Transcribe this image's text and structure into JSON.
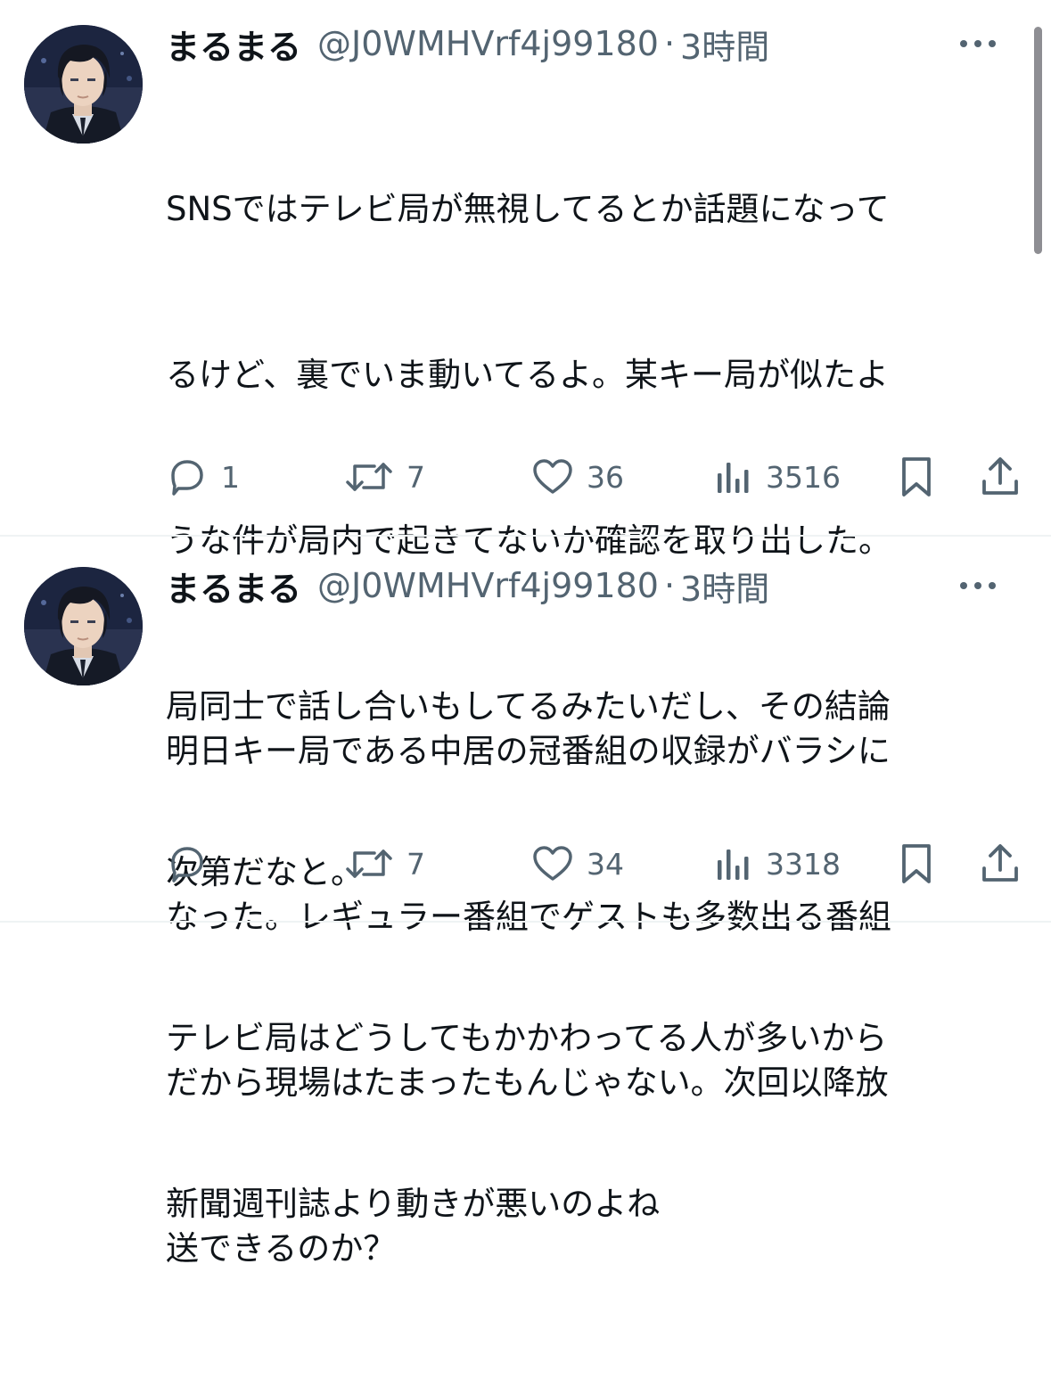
{
  "tweets": [
    {
      "display_name": "まるまる",
      "handle": "@J0WMHVrf4j99180",
      "separator": "·",
      "time": "3時間",
      "text": "SNSではテレビ局が無視してるとか話題になってるけど、裏でいま動いてるよ。某キー局が似たような件が局内で起きてないか確認を取り出した。局同士で話し合いもしてるみたいだし、その結論次第だなと。\nテレビ局はどうしてもかかわってる人が多いから新聞週刊誌より動きが悪いのよね",
      "lines": [
        "SNSではテレビ局が無視してるとか話題になって",
        "るけど、裏でいま動いてるよ。某キー局が似たよ",
        "うな件が局内で起きてないか確認を取り出した。",
        "局同士で話し合いもしてるみたいだし、その結論",
        "次第だなと。",
        "テレビ局はどうしてもかかわってる人が多いから",
        "新聞週刊誌より動きが悪いのよね"
      ],
      "replies": "1",
      "reposts": "7",
      "likes": "36",
      "views": "3516"
    },
    {
      "display_name": "まるまる",
      "handle": "@J0WMHVrf4j99180",
      "separator": "·",
      "time": "3時間",
      "text": "明日キー局である中居の冠番組の収録がバラシになった。レギュラー番組でゲストも多数出る番組だから現場はたまったもんじゃない。次回以降放送できるのか？",
      "lines": [
        "明日キー局である中居の冠番組の収録がバラシに",
        "なった。レギュラー番組でゲストも多数出る番組",
        "だから現場はたまったもんじゃない。次回以降放",
        "送できるのか？"
      ],
      "replies": "",
      "reposts": "7",
      "likes": "34",
      "views": "3318"
    }
  ],
  "icons": {
    "more": "more-dots-icon",
    "reply": "reply-bubble-icon",
    "repost": "repost-arrows-icon",
    "like": "heart-icon",
    "views": "views-bars-icon",
    "bookmark": "bookmark-icon",
    "share": "share-upload-icon"
  },
  "colors": {
    "text": "#0f1419",
    "secondary": "#536471",
    "divider": "#eff3f4",
    "scrollbar": "#8e8e93"
  }
}
